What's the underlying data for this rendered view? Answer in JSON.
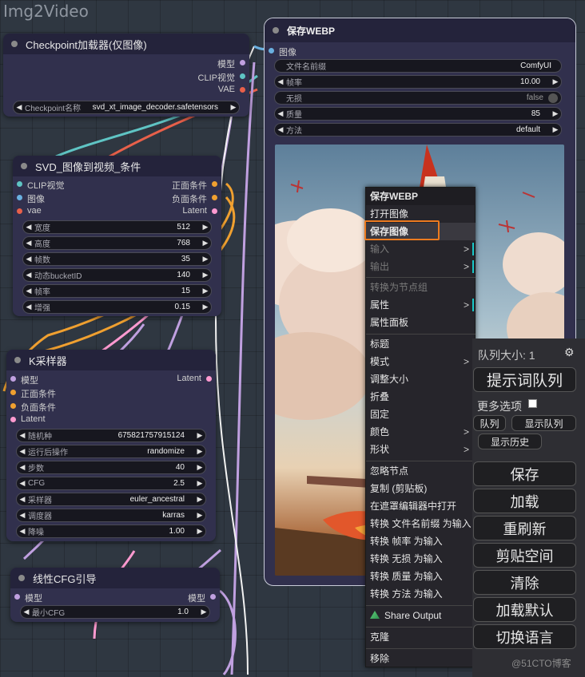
{
  "canvas": {
    "title": "Img2Video"
  },
  "nodes": {
    "checkpoint": {
      "title": "Checkpoint加载器(仅图像)",
      "outputs": [
        "模型",
        "CLIP视觉",
        "VAE"
      ],
      "widget": {
        "label": "Checkpoint名称",
        "value": "svd_xt_image_decoder.safetensors"
      }
    },
    "svd": {
      "title": "SVD_图像到视频_条件",
      "inputs": [
        "CLIP视觉",
        "图像",
        "vae"
      ],
      "outputs": [
        "正面条件",
        "负面条件",
        "Latent"
      ],
      "widgets": [
        {
          "label": "宽度",
          "value": "512"
        },
        {
          "label": "高度",
          "value": "768"
        },
        {
          "label": "帧数",
          "value": "35"
        },
        {
          "label": "动态bucketID",
          "value": "140"
        },
        {
          "label": "帧率",
          "value": "15"
        },
        {
          "label": "增强",
          "value": "0.15"
        }
      ]
    },
    "ksampler": {
      "title": "K采样器",
      "inputs": [
        "模型",
        "正面条件",
        "负面条件",
        "Latent"
      ],
      "output": "Latent",
      "widgets": [
        {
          "label": "随机种",
          "value": "675821757915124"
        },
        {
          "label": "运行后操作",
          "value": "randomize"
        },
        {
          "label": "步数",
          "value": "40"
        },
        {
          "label": "CFG",
          "value": "2.5"
        },
        {
          "label": "采样器",
          "value": "euler_ancestral"
        },
        {
          "label": "调度器",
          "value": "karras"
        },
        {
          "label": "降噪",
          "value": "1.00"
        }
      ]
    },
    "cfg_guide": {
      "title": "线性CFG引导",
      "input": "模型",
      "output": "模型",
      "widget": {
        "label": "最小CFG",
        "value": "1.0"
      }
    },
    "save_webp": {
      "title": "保存WEBP",
      "input": "图像",
      "widgets": [
        {
          "label": "文件名前缀",
          "value": "ComfyUI"
        },
        {
          "label": "帧率",
          "value": "10.00"
        },
        {
          "label": "无损",
          "value": "false"
        },
        {
          "label": "质量",
          "value": "85"
        },
        {
          "label": "方法",
          "value": "default"
        }
      ]
    }
  },
  "context_menu": {
    "title": "保存WEBP",
    "items": [
      "打开图像",
      "保存图像",
      "输入",
      "输出",
      "转换为节点组",
      "属性",
      "属性面板",
      "标题",
      "模式",
      "调整大小",
      "折叠",
      "固定",
      "颜色",
      "形状",
      "忽略节点",
      "复制 (剪贴板)",
      "在遮罩编辑器中打开",
      "转换 文件名前缀 为输入",
      "转换 帧率 为输入",
      "转换 无损 为输入",
      "转换 质量 为输入",
      "转换 方法 为输入",
      "Share Output",
      "克隆",
      "移除"
    ]
  },
  "queue_panel": {
    "queue_size": "队列大小: 1",
    "queue_prompt": "提示词队列",
    "more_options": "更多选项",
    "queue_small": "队列",
    "view_queue": "显示队列",
    "view_history": "显示历史",
    "buttons": [
      "保存",
      "加载",
      "重刷新",
      "剪贴空间",
      "清除",
      "加载默认",
      "切换语言"
    ]
  },
  "watermark": "@51CTO博客",
  "colors": {
    "accent_orange": "#ec7b1f",
    "menu_bg": "#26252b",
    "node_bg": "#31304d",
    "canvas_bg": "#2f3741"
  }
}
